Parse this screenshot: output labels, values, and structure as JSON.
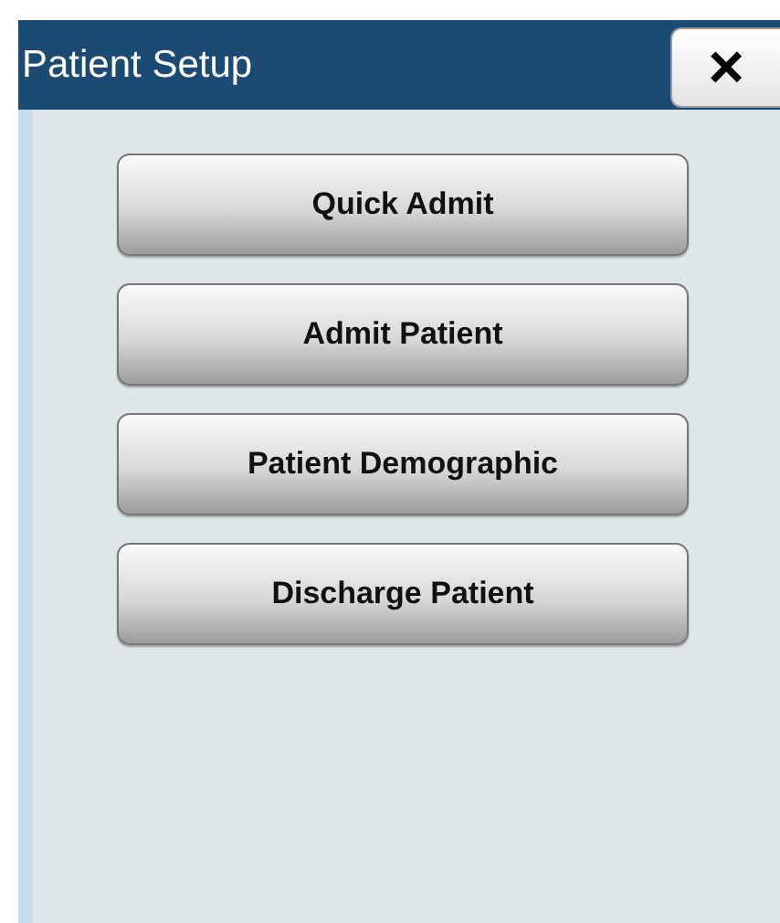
{
  "window": {
    "title": "Patient Setup",
    "close": "×"
  },
  "buttons": [
    {
      "label": "Quick Admit"
    },
    {
      "label": "Admit Patient"
    },
    {
      "label": "Patient Demographic"
    },
    {
      "label": "Discharge Patient"
    }
  ]
}
